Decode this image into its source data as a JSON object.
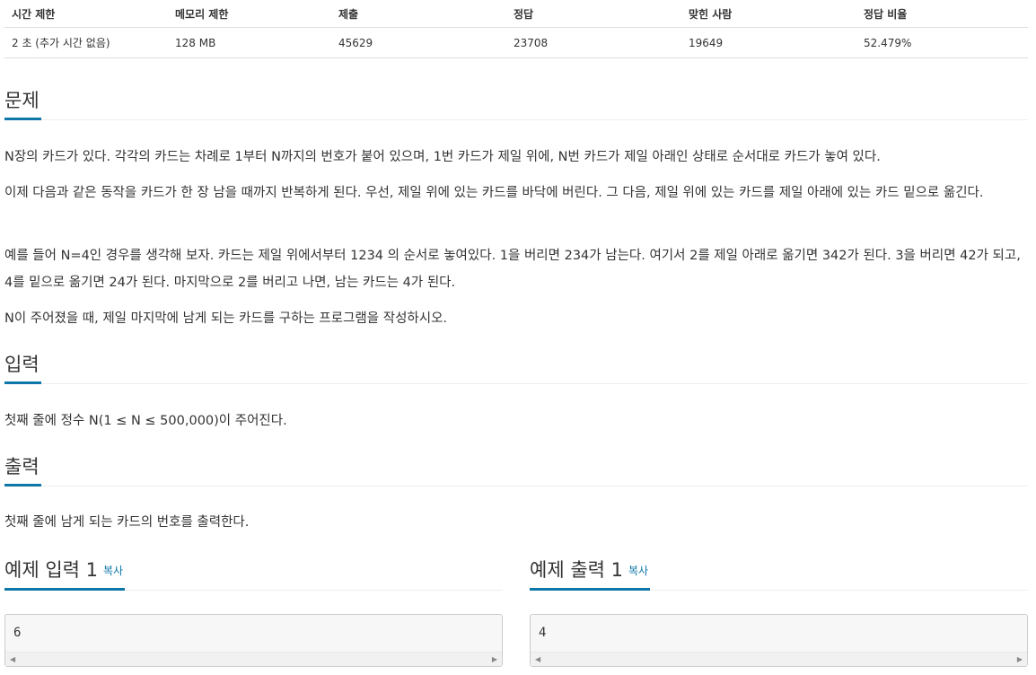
{
  "stats": {
    "headers": [
      "시간 제한",
      "메모리 제한",
      "제출",
      "정답",
      "맞힌 사람",
      "정답 비율"
    ],
    "values": [
      "2 초 (추가 시간 없음)",
      "128 MB",
      "45629",
      "23708",
      "19649",
      "52.479%"
    ]
  },
  "problem": {
    "title": "문제",
    "paragraphs": [
      "N장의 카드가 있다. 각각의 카드는 차례로 1부터 N까지의 번호가 붙어 있으며, 1번 카드가 제일 위에, N번 카드가 제일 아래인 상태로 순서대로 카드가 놓여 있다.",
      "이제 다음과 같은 동작을 카드가 한 장 남을 때까지 반복하게 된다. 우선, 제일 위에 있는 카드를 바닥에 버린다. 그 다음, 제일 위에 있는 카드를 제일 아래에 있는 카드 밑으로 옮긴다.",
      "예를 들어 N=4인 경우를 생각해 보자. 카드는 제일 위에서부터 1234 의 순서로 놓여있다. 1을 버리면 234가 남는다. 여기서 2를 제일 아래로 옮기면 342가 된다. 3을 버리면 42가 되고, 4를 밑으로 옮기면 24가 된다. 마지막으로 2를 버리고 나면, 남는 카드는 4가 된다.",
      "N이 주어졌을 때, 제일 마지막에 남게 되는 카드를 구하는 프로그램을 작성하시오."
    ]
  },
  "input": {
    "title": "입력",
    "text": "첫째 줄에 정수 N(1 ≤ N ≤ 500,000)이 주어진다."
  },
  "output": {
    "title": "출력",
    "text": "첫째 줄에 남게 되는 카드의 번호를 출력한다."
  },
  "sample_input": {
    "title": "예제 입력 1",
    "copy_label": "복사",
    "value": "6"
  },
  "sample_output": {
    "title": "예제 출력 1",
    "copy_label": "복사",
    "value": "4"
  }
}
